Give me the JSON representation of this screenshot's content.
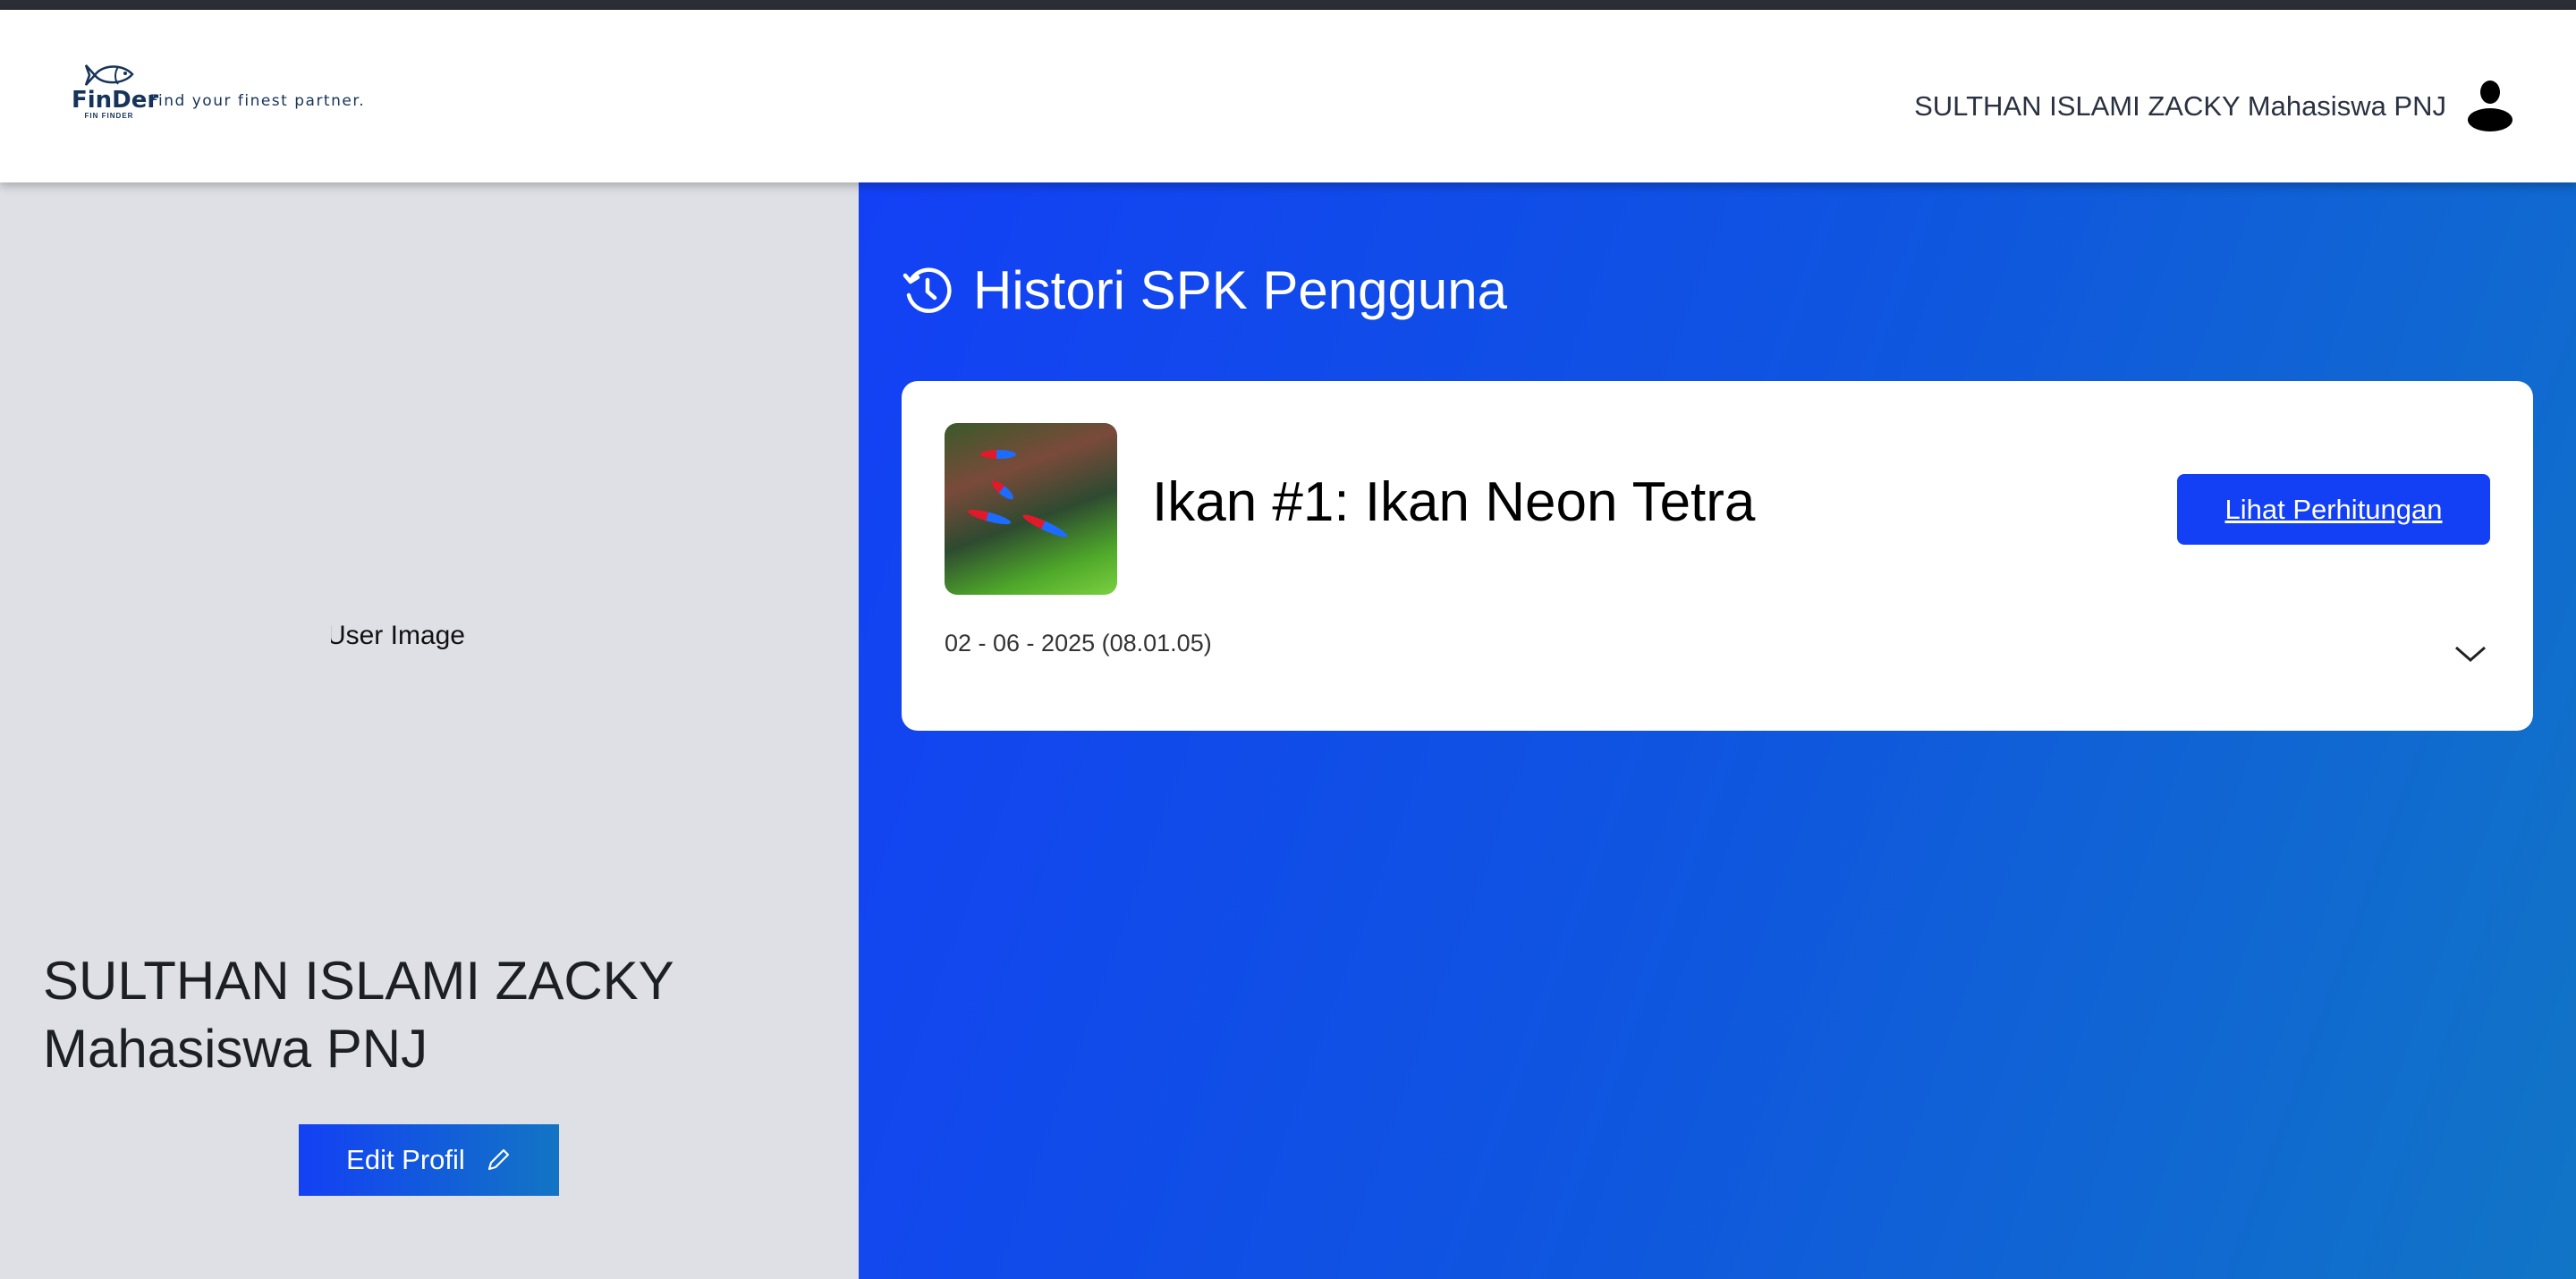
{
  "header": {
    "logo_brand": "FinDer",
    "logo_sub": "FIN FINDER",
    "tagline": "Find your finest partner.",
    "user_name": "SULTHAN ISLAMI ZACKY Mahasiswa PNJ",
    "avatar_icon": "user-icon"
  },
  "profile": {
    "image_alt": "User Image",
    "name": "SULTHAN ISLAMI ZACKY Mahasiswa PNJ",
    "edit_label": "Edit Profil",
    "edit_icon": "pencil-icon"
  },
  "history": {
    "title": "Histori SPK Pengguna",
    "title_icon": "history-icon",
    "items": [
      {
        "title": "Ikan #1: Ikan Neon Tetra",
        "date": "02 - 06 - 2025 (08.01.05)",
        "button_label": "Lihat Perhitungan",
        "toggle_icon": "chevron-down-icon"
      }
    ]
  },
  "colors": {
    "accent": "#1340f5",
    "accent_end": "#1275c4",
    "panel": "#dfe0e6"
  }
}
